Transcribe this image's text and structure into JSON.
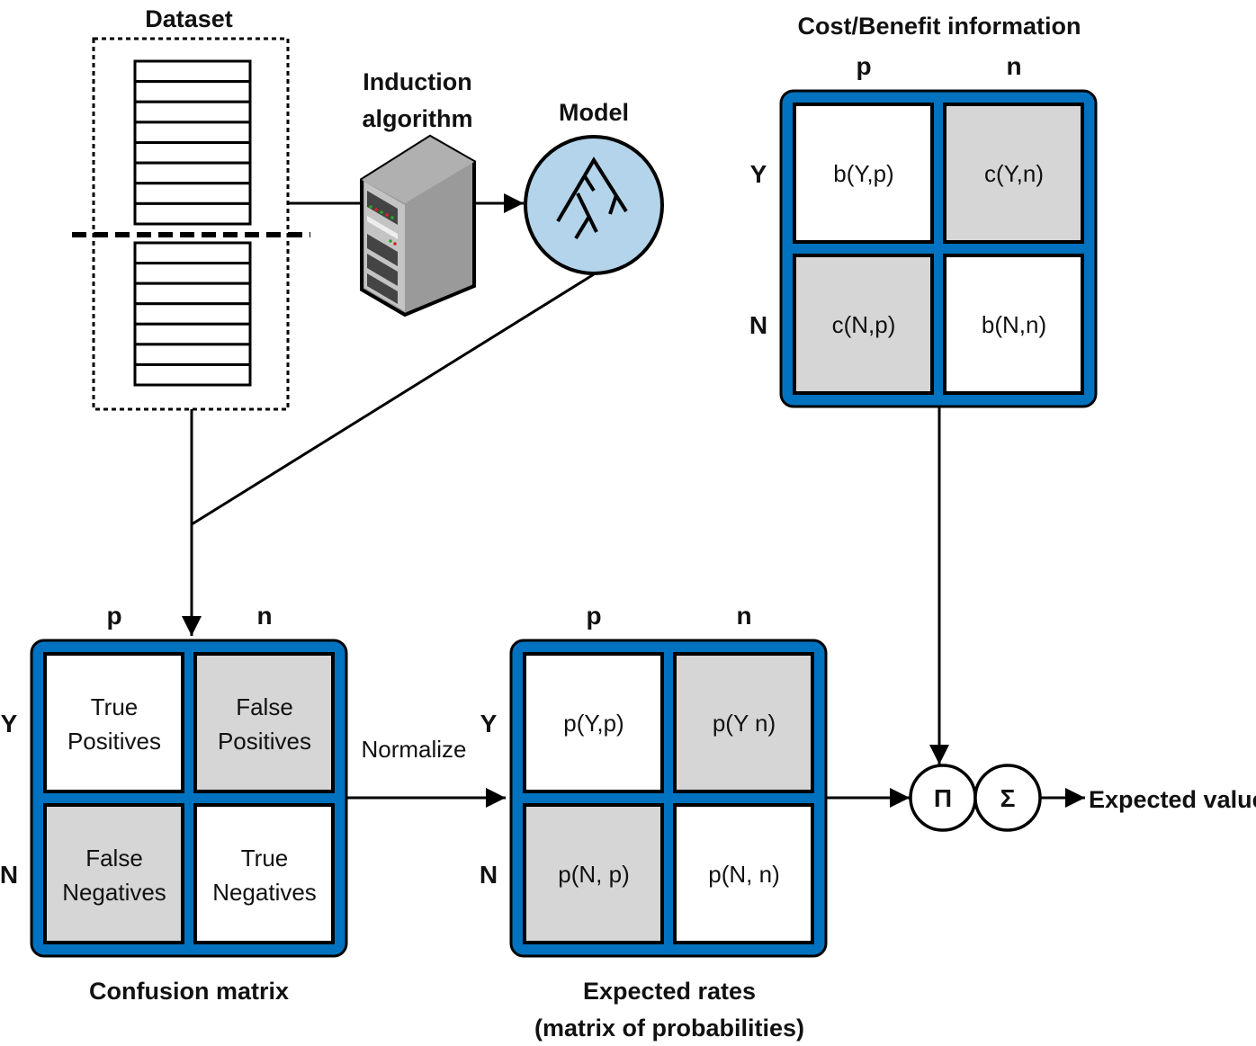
{
  "colors": {
    "matrix_border": "#0072bf",
    "shaded_cell": "#d6d6d6",
    "model_fill": "#b3d4ea"
  },
  "dataset": {
    "title": "Dataset"
  },
  "induction": {
    "line1": "Induction",
    "line2": "algorithm",
    "icon": "server-icon"
  },
  "model": {
    "title": "Model",
    "icon": "decision-tree-icon"
  },
  "cost_benefit": {
    "title": "Cost/Benefit information",
    "cols": [
      "p",
      "n"
    ],
    "rows": [
      "Y",
      "N"
    ],
    "cells": [
      [
        "b(Y,p)",
        "c(Y,n)"
      ],
      [
        "c(N,p)",
        "b(N,n)"
      ]
    ]
  },
  "confusion": {
    "title": "Confusion matrix",
    "cols": [
      "p",
      "n"
    ],
    "rows": [
      "Y",
      "N"
    ],
    "cells": [
      [
        [
          "True",
          "Positives"
        ],
        [
          "False",
          "Positives"
        ]
      ],
      [
        [
          "False",
          "Negatives"
        ],
        [
          "True",
          "Negatives"
        ]
      ]
    ]
  },
  "normalize": {
    "label": "Normalize"
  },
  "expected_rates": {
    "title_line1": "Expected rates",
    "title_line2": "(matrix of probabilities)",
    "cols": [
      "p",
      "n"
    ],
    "rows": [
      "Y",
      "N"
    ],
    "cells": [
      [
        "p(Y,p)",
        "p(Y n)"
      ],
      [
        "p(N, p)",
        "p(N, n)"
      ]
    ]
  },
  "operators": {
    "product": "Π",
    "sum": "Σ"
  },
  "output": {
    "label": "Expected value"
  }
}
